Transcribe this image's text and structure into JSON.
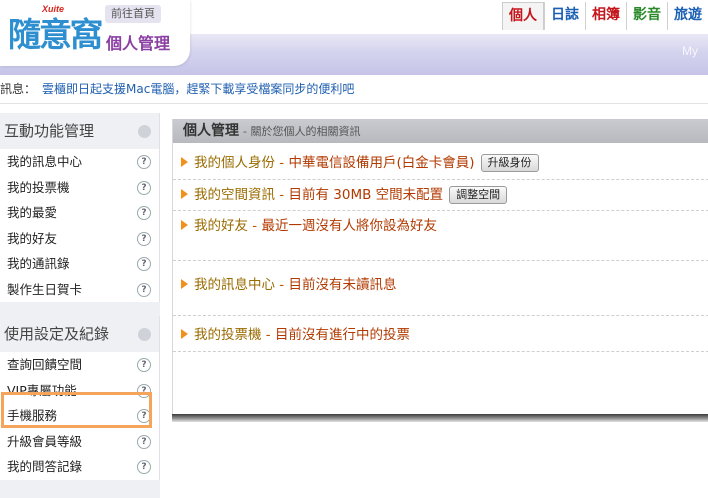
{
  "header": {
    "brand_mark": "Xuite",
    "logo": "隨意窩",
    "home_link": "前往首頁",
    "subtitle": "個人管理",
    "watermark": "My",
    "tabs": [
      "個人",
      "日誌",
      "相簿",
      "影音",
      "旅遊"
    ]
  },
  "message": {
    "label": "訊息：",
    "text": "雲櫃即日起支援Mac電腦，趕緊下載享受檔案同步的便利吧"
  },
  "sidebar": {
    "section1": {
      "title": "互動功能管理",
      "items": [
        "我的訊息中心",
        "我的投票機",
        "我的最愛",
        "我的好友",
        "我的通訊錄",
        "製作生日賀卡"
      ]
    },
    "section2": {
      "title": "使用設定及紀錄",
      "items": [
        "查詢回饋空間",
        "VIP專屬功能",
        "手機服務",
        "升級會員等級",
        "我的問答記錄"
      ]
    },
    "help_glyph": "?"
  },
  "main": {
    "title": "個人管理",
    "subtitle": "- 關於您個人的相關資訊",
    "rows": [
      {
        "title": "我的個人身份",
        "sep": " - ",
        "value": "中華電信設備用戶(白金卡會員)",
        "button": "升級身份"
      },
      {
        "title": "我的空間資訊",
        "sep": " - ",
        "value": "目前有 30MB 空間未配置",
        "button": "調整空間"
      },
      {
        "title": "我的好友",
        "sep": " - ",
        "value": "最近一週沒有人將你設為好友"
      },
      {
        "title": "我的訊息中心",
        "sep": " - ",
        "value": "目前沒有未讀訊息"
      },
      {
        "title": "我的投票機",
        "sep": " - ",
        "value": "目前沒有進行中的投票"
      }
    ]
  },
  "colors": {
    "accent_orange": "#f0901e",
    "link_blue": "#1f5fb0",
    "highlight": "#f4a55b"
  }
}
